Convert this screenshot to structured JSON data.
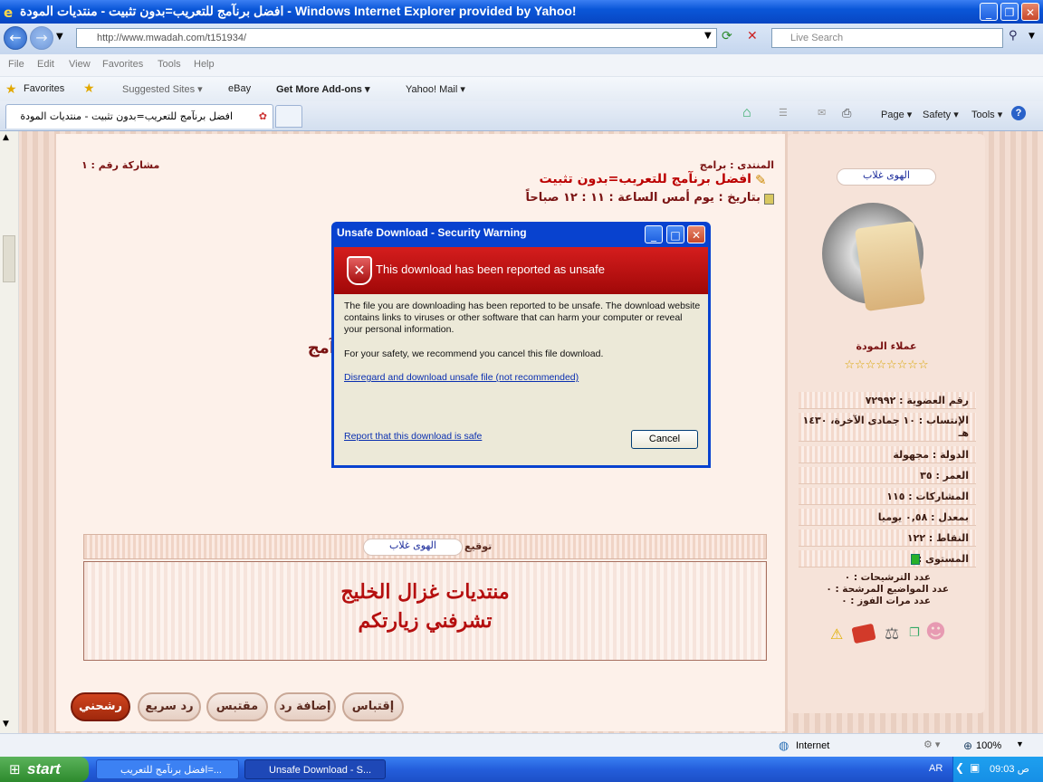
{
  "browser": {
    "window_title": "افضل برنآمج للتعريب=بدون تثبيت - منتديات المودة - Windows Internet Explorer provided by Yahoo!",
    "url": "http://www.mwadah.com/t151934/",
    "search_placeholder": "Live Search",
    "menu": [
      "File",
      "Edit",
      "View",
      "Favorites",
      "Tools",
      "Help"
    ],
    "favorites_label": "Favorites",
    "fav_links": [
      "Suggested Sites ▾",
      "eBay",
      "Get More Add-ons ▾",
      "Yahoo! Mail ▾"
    ],
    "tab_title": "افضل برنآمج للتعريب=بدون تثبيت - منتديات المودة",
    "commands": [
      "Page ▾",
      "Safety ▾",
      "Tools ▾"
    ]
  },
  "post": {
    "forum_label": "المنتدى : برامج",
    "title": "افضل برنآمج للتعريب=بدون تثبيت",
    "date": "بتاريخ : يوم أمس الساعة : ١١ : ١٢ صباحاً",
    "post_number": "مشاركة رقم : ١",
    "partial_text": "آمج",
    "signature_label": "توقيع",
    "signature_name": "الهوى غلاب",
    "signature_line1": "منتديات غزال الخليج",
    "signature_line2": "تشرفني زيارتكم",
    "actions": [
      "رشحني",
      "رد سريع",
      "مقتبس",
      "إضافة رد",
      "إقتباس"
    ]
  },
  "user": {
    "name": "الهوى غلاب",
    "group": "عملاء المودة",
    "stars": "☆☆☆☆☆☆☆☆",
    "fields": [
      "رقم العضوية : ٧٢٩٩٢",
      "الإنتساب : ١٠ جمادى الآخرة، ١٤٣٠ هـ",
      "الدولة : مجهولة",
      "العمر : ٣٥",
      "المشاركات : ١١٥",
      "بمعدل : ٠,٥٨ يوميا",
      "النقاط : ١٢٢",
      "المستوى :"
    ],
    "nominations": "عدد الترشيحات : ٠",
    "nominated_topics": "عدد المواضيع المرشحة : ٠",
    "wins": "عدد مرات الفوز : ٠"
  },
  "dialog": {
    "title": "Unsafe Download - Security Warning",
    "header": "This download has been reported as unsafe",
    "body1": "The file you are downloading has been reported to be unsafe. The download website contains links to viruses or other software that can harm your computer or reveal your personal information.",
    "body2": "For your safety, we recommend you cancel this file download.",
    "disregard_link": "Disregard and download unsafe file (not recommended)",
    "report_link": "Report that this download is safe",
    "cancel_label": "Cancel"
  },
  "status": {
    "zone": "Internet",
    "zoom": "100%"
  },
  "taskbar": {
    "start": "start",
    "tasks": [
      "افضل برنآمج للتعريب=...",
      "Unsafe Download - S..."
    ],
    "lang": "AR",
    "clock": "09:03 ص"
  }
}
